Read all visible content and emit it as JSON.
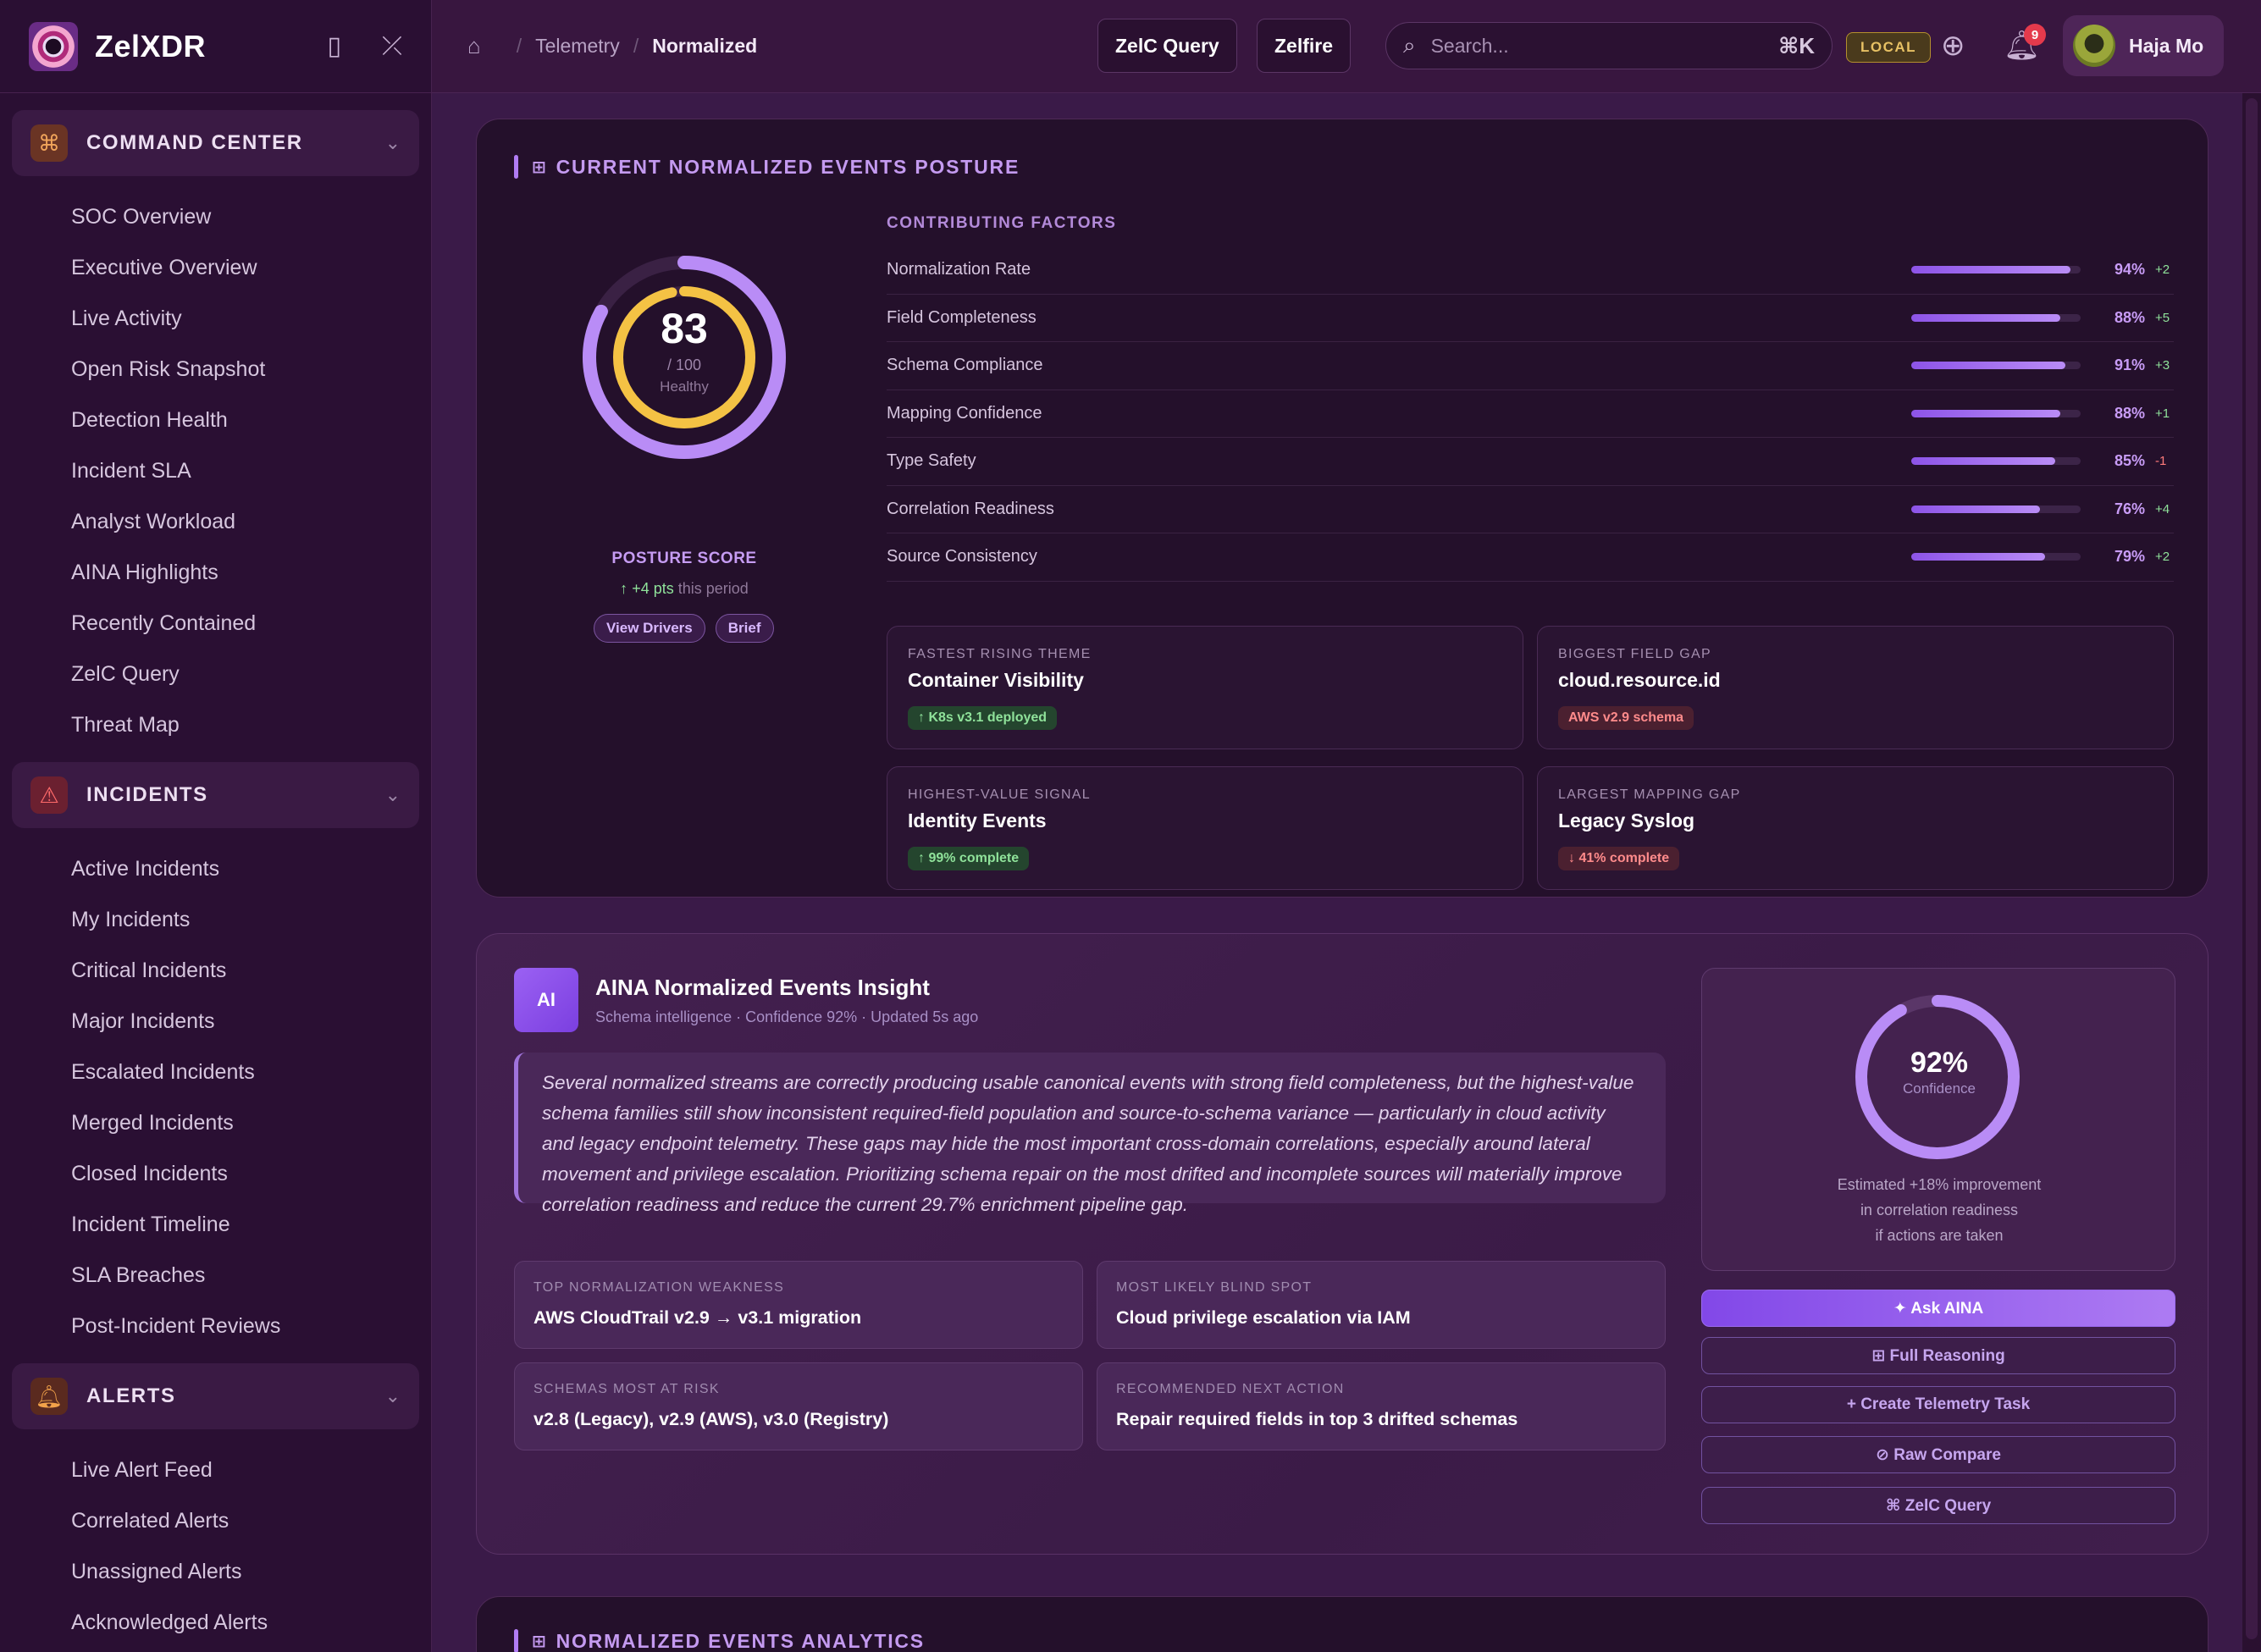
{
  "brand": {
    "name": "ZelXDR"
  },
  "sidebar": {
    "groups": [
      {
        "label": "COMMAND CENTER",
        "icon": "command-icon",
        "items": [
          "SOC Overview",
          "Executive Overview",
          "Live Activity",
          "Open Risk Snapshot",
          "Detection Health",
          "Incident SLA",
          "Analyst Workload",
          "AINA Highlights",
          "Recently Contained",
          "ZelC Query",
          "Threat Map"
        ]
      },
      {
        "label": "INCIDENTS",
        "icon": "warning-icon",
        "items": [
          "Active Incidents",
          "My Incidents",
          "Critical Incidents",
          "Major Incidents",
          "Escalated Incidents",
          "Merged Incidents",
          "Closed Incidents",
          "Incident Timeline",
          "SLA Breaches",
          "Post-Incident Reviews"
        ]
      },
      {
        "label": "ALERTS",
        "icon": "bell-icon",
        "items": [
          "Live Alert Feed",
          "Correlated Alerts",
          "Unassigned Alerts",
          "Acknowledged Alerts"
        ]
      }
    ]
  },
  "topbar": {
    "breadcrumb": [
      "Telemetry",
      "Normalized"
    ],
    "btn_query": "ZelC Query",
    "btn_zelfire": "Zelfire",
    "search_placeholder": "Search...",
    "search_shortcut": "⌘K",
    "env_badge": "LOCAL",
    "notification_count": "9",
    "user_name": "Haja Mo"
  },
  "posture": {
    "title": "CURRENT NORMALIZED EVENTS POSTURE",
    "score": 83,
    "score_max": "/ 100",
    "score_status": "Healthy",
    "score_label": "POSTURE SCORE",
    "delta": "+4 pts",
    "delta_suffix": "this period",
    "btn_drivers": "View Drivers",
    "btn_brief": "Brief",
    "factors_title": "CONTRIBUTING FACTORS",
    "factors": [
      {
        "name": "Normalization Rate",
        "value": 94,
        "label": "94%",
        "delta": "+2"
      },
      {
        "name": "Field Completeness",
        "value": 88,
        "label": "88%",
        "delta": "+5"
      },
      {
        "name": "Schema Compliance",
        "value": 91,
        "label": "91%",
        "delta": "+3"
      },
      {
        "name": "Mapping Confidence",
        "value": 88,
        "label": "88%",
        "delta": "+1"
      },
      {
        "name": "Type Safety",
        "value": 85,
        "label": "85%",
        "delta": "-1"
      },
      {
        "name": "Correlation Readiness",
        "value": 76,
        "label": "76%",
        "delta": "+4"
      },
      {
        "name": "Source Consistency",
        "value": 79,
        "label": "79%",
        "delta": "+2"
      }
    ],
    "cards": [
      {
        "title": "FASTEST RISING THEME",
        "value": "Container Visibility",
        "badge": "↑ K8s v3.1 deployed",
        "tone": "green"
      },
      {
        "title": "BIGGEST FIELD GAP",
        "value": "cloud.resource.id",
        "badge": "AWS v2.9 schema",
        "tone": "red"
      },
      {
        "title": "HIGHEST-VALUE SIGNAL",
        "value": "Identity Events",
        "badge": "↑ 99% complete",
        "tone": "green"
      },
      {
        "title": "LARGEST MAPPING GAP",
        "value": "Legacy Syslog",
        "badge": "↓ 41% complete",
        "tone": "red"
      }
    ]
  },
  "insight": {
    "badge": "AI",
    "title": "AINA Normalized Events Insight",
    "subtitle": "Schema intelligence · Confidence 92% · Updated 5s ago",
    "summary": "Several normalized streams are correctly producing usable canonical events with strong field completeness, but the highest-value schema families still show inconsistent required-field population and source-to-schema variance — particularly in cloud activity and legacy endpoint telemetry. These gaps may hide the most important cross-domain correlations, especially around lateral movement and privilege escalation. Prioritizing schema repair on the most drifted and incomplete sources will materially improve correlation readiness and reduce the current 29.7% enrichment pipeline gap.",
    "cards": [
      {
        "title": "TOP NORMALIZATION WEAKNESS",
        "value": "AWS CloudTrail v2.9 → v3.1 migration"
      },
      {
        "title": "MOST LIKELY BLIND SPOT",
        "value": "Cloud privilege escalation via IAM"
      },
      {
        "title": "SCHEMAS MOST AT RISK",
        "value": "v2.8 (Legacy), v2.9 (AWS), v3.0 (Registry)"
      },
      {
        "title": "RECOMMENDED NEXT ACTION",
        "value": "Repair required fields in top 3 drifted schemas"
      }
    ],
    "confidence": 92,
    "confidence_label": "92%",
    "confidence_caption": "Confidence",
    "confidence_note": [
      "Estimated +18% improvement",
      "in correlation readiness",
      "if actions are taken"
    ],
    "actions": [
      "✦ Ask AINA",
      "⊞ Full Reasoning",
      "+ Create Telemetry Task",
      "⊘ Raw Compare",
      "⌘ ZelC Query"
    ]
  },
  "analytics": {
    "title": "NORMALIZED EVENTS ANALYTICS"
  },
  "colors": {
    "accent": "#b07cf3",
    "ring_outer": "#b98cf6",
    "ring_inner": "#f4c244",
    "good": "#8fe29a",
    "bad": "#ff7b7b"
  }
}
